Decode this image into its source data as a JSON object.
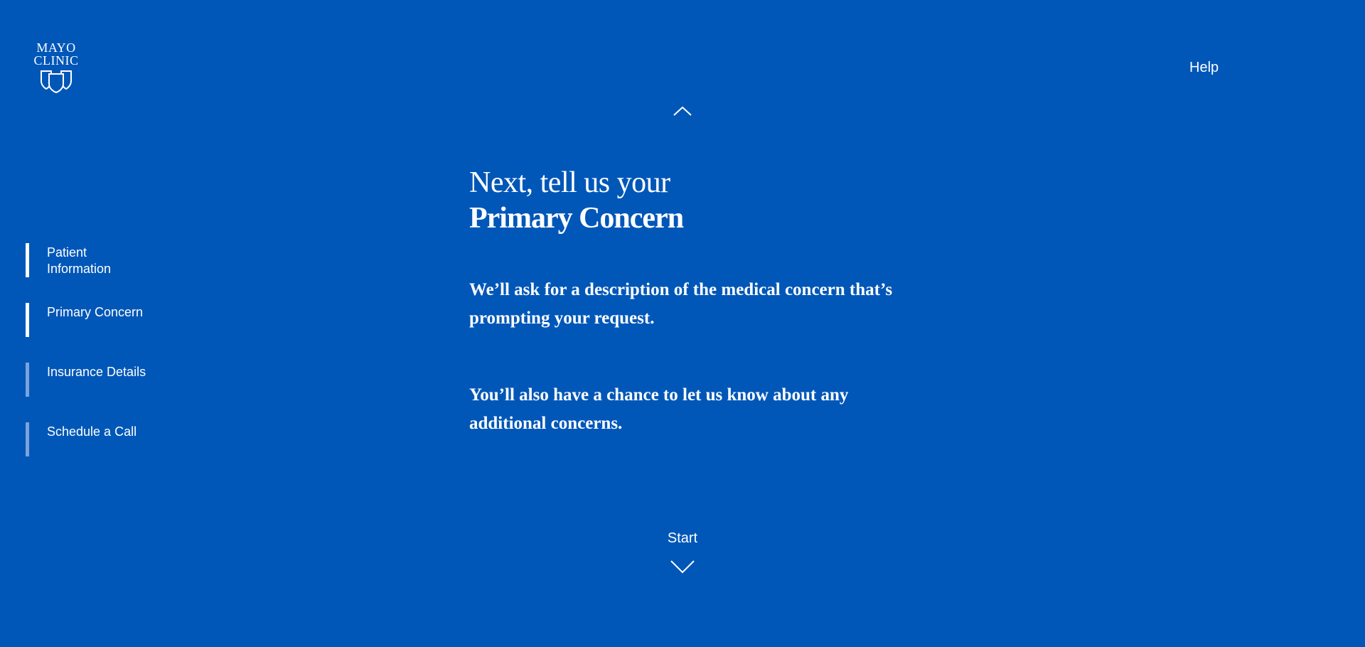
{
  "brand": {
    "logo_line1": "MAYO",
    "logo_line2": "CLINIC",
    "logo_icon": "triple-shield-icon"
  },
  "header": {
    "help_label": "Help"
  },
  "steps": [
    {
      "label": "Patient Information",
      "state": "completed"
    },
    {
      "label": "Primary Concern",
      "state": "current"
    },
    {
      "label": "Insurance Details",
      "state": "upcoming"
    },
    {
      "label": "Schedule a Call",
      "state": "upcoming"
    }
  ],
  "main": {
    "heading_line1": "Next, tell us your",
    "heading_line2": "Primary Concern",
    "paragraph1": "We’ll ask for a description of the medical concern that’s prompting your request.",
    "paragraph2": "You’ll also have a chance to let us know about any additional concerns."
  },
  "navigation": {
    "up_icon": "chevron-up-icon",
    "start_label": "Start",
    "down_icon": "chevron-down-icon"
  },
  "colors": {
    "background": "#0057b8",
    "text": "#ffffff",
    "step_active": "#ffffff",
    "step_inactive": "#7aa3de"
  }
}
